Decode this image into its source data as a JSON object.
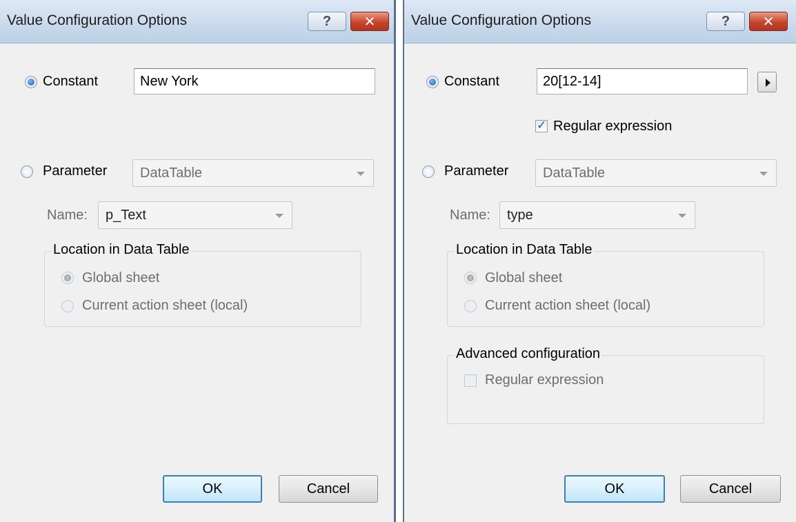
{
  "left_dialog": {
    "title": "Value Configuration Options",
    "help_glyph": "?",
    "close_glyph": "✕",
    "constant": {
      "label": "Constant",
      "value": "New York",
      "selected": true
    },
    "parameter": {
      "label": "Parameter",
      "type_value": "DataTable",
      "selected": false
    },
    "name_label": "Name:",
    "name_value": "p_Text",
    "location": {
      "legend": "Location in Data Table",
      "global": "Global sheet",
      "local": "Current action sheet (local)"
    },
    "ok_label": "OK",
    "cancel_label": "Cancel"
  },
  "right_dialog": {
    "title": "Value Configuration Options",
    "help_glyph": "?",
    "close_glyph": "✕",
    "constant": {
      "label": "Constant",
      "value": "20[12-14]",
      "selected": true
    },
    "regex_label": "Regular expression",
    "regex_checked": true,
    "parameter": {
      "label": "Parameter",
      "type_value": "DataTable",
      "selected": false
    },
    "name_label": "Name:",
    "name_value": "type",
    "location": {
      "legend": "Location in Data Table",
      "global": "Global sheet",
      "local": "Current action sheet (local)"
    },
    "advanced": {
      "legend": "Advanced configuration",
      "regex_label": "Regular expression",
      "regex_checked": false
    },
    "ok_label": "OK",
    "cancel_label": "Cancel"
  },
  "icons": [
    "help-icon",
    "close-icon",
    "chevron-down-icon",
    "play-arrow-icon"
  ]
}
